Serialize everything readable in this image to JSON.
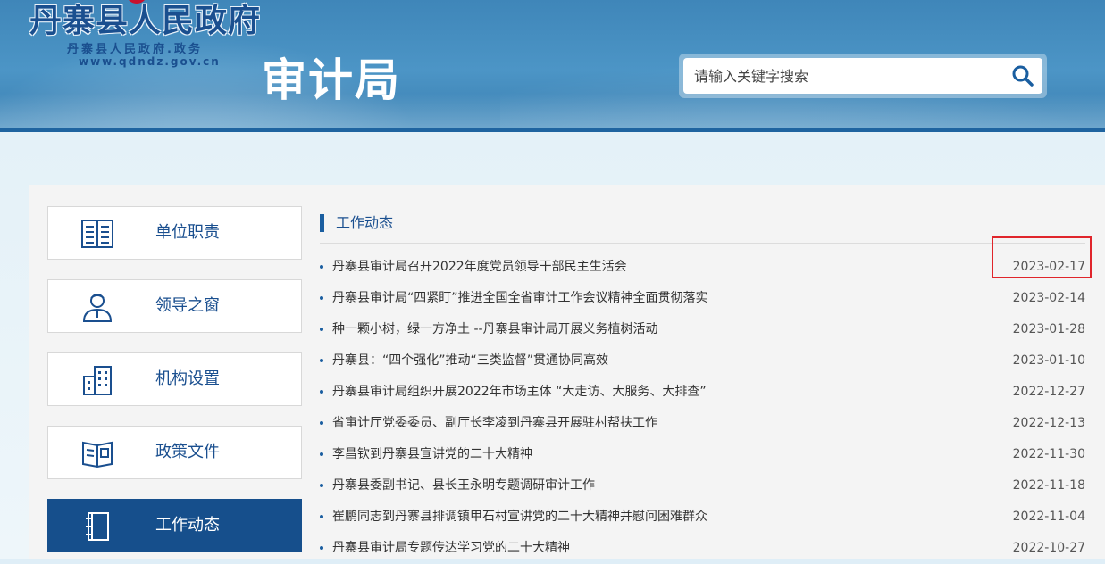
{
  "header": {
    "logo_main": "丹寨县人民政府",
    "logo_sub": "丹寨县人民政府.政务",
    "logo_url": "www.qdndz.gov.cn",
    "dept_title": "审计局",
    "search_placeholder": "请输入关键字搜索"
  },
  "sidebar": {
    "items": [
      {
        "label": "单位职责",
        "icon": "document-list-icon",
        "active": false
      },
      {
        "label": "领导之窗",
        "icon": "person-icon",
        "active": false
      },
      {
        "label": "机构设置",
        "icon": "building-icon",
        "active": false
      },
      {
        "label": "政策文件",
        "icon": "open-book-icon",
        "active": false
      },
      {
        "label": "工作动态",
        "icon": "notebook-icon",
        "active": true
      }
    ]
  },
  "section": {
    "title": "工作动态"
  },
  "news": [
    {
      "title": "丹寨县审计局召开2022年度党员领导干部民主生活会",
      "date": "2023-02-17"
    },
    {
      "title": "丹寨县审计局“四紧盯”推进全国全省审计工作会议精神全面贯彻落实",
      "date": "2023-02-14"
    },
    {
      "title": "种一颗小树，绿一方净土 --丹寨县审计局开展义务植树活动",
      "date": "2023-01-28"
    },
    {
      "title": " 丹寨县：“四个强化”推动“三类监督”贯通协同高效",
      "date": "2023-01-10"
    },
    {
      "title": "丹寨县审计局组织开展2022年市场主体 “大走访、大服务、大排查”",
      "date": "2022-12-27"
    },
    {
      "title": "省审计厅党委委员、副厅长李凌到丹寨县开展驻村帮扶工作",
      "date": "2022-12-13"
    },
    {
      "title": "李昌钦到丹寨县宣讲党的二十大精神",
      "date": "2022-11-30"
    },
    {
      "title": "丹寨县委副书记、县长王永明专题调研审计工作",
      "date": "2022-11-18"
    },
    {
      "title": "崔鹏同志到丹寨县排调镇甲石村宣讲党的二十大精神并慰问困难群众",
      "date": "2022-11-04"
    },
    {
      "title": "丹寨县审计局专题传达学习党的二十大精神",
      "date": "2022-10-27"
    }
  ],
  "colors": {
    "primary": "#1a4f8f",
    "active_bg": "#164f8c",
    "highlight": "#e0252b"
  }
}
